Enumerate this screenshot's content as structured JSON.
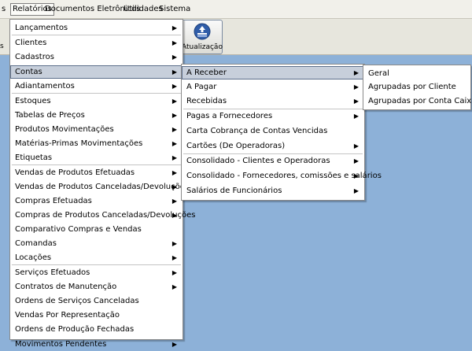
{
  "menubar": {
    "items": [
      "s",
      "Relatórios",
      "Documentos Eletrônicos",
      "Utilidades",
      "Sistema"
    ]
  },
  "toolbar": {
    "left_label": "s",
    "button_label": "Atualização",
    "button_icon": "update-icon"
  },
  "relatorios_menu": {
    "items": [
      {
        "label": "Lançamentos",
        "submenu": true
      },
      {
        "label": "Clientes",
        "submenu": true
      },
      {
        "label": "Cadastros",
        "submenu": true
      },
      {
        "label": "Contas",
        "submenu": true
      },
      {
        "label": "Adiantamentos",
        "submenu": true
      },
      {
        "label": "Estoques",
        "submenu": true
      },
      {
        "label": "Tabelas de Preços",
        "submenu": true
      },
      {
        "label": "Produtos Movimentações",
        "submenu": true
      },
      {
        "label": "Matérias-Primas Movimentações",
        "submenu": true
      },
      {
        "label": "Etiquetas",
        "submenu": true
      },
      {
        "label": "Vendas de Produtos Efetuadas",
        "submenu": true
      },
      {
        "label": "Vendas de Produtos Canceladas/Devoluções",
        "submenu": true
      },
      {
        "label": "Compras Efetuadas",
        "submenu": true
      },
      {
        "label": "Compras de Produtos Canceladas/Devoluções",
        "submenu": true
      },
      {
        "label": "Comparativo Compras e Vendas",
        "submenu": false
      },
      {
        "label": "Comandas",
        "submenu": true
      },
      {
        "label": "Locações",
        "submenu": true
      },
      {
        "label": "Serviços Efetuados",
        "submenu": true
      },
      {
        "label": "Contratos de Manutenção",
        "submenu": true
      },
      {
        "label": "Ordens de Serviços Canceladas",
        "submenu": false
      },
      {
        "label": "Vendas Por Representação",
        "submenu": false
      },
      {
        "label": "Ordens de Produção Fechadas",
        "submenu": false
      },
      {
        "label": "Movimentos Pendentes",
        "submenu": true
      }
    ]
  },
  "contas_menu": {
    "items": [
      {
        "label": "A Receber",
        "submenu": true
      },
      {
        "label": "A Pagar",
        "submenu": true
      },
      {
        "label": "Recebidas",
        "submenu": true
      },
      {
        "label": "Pagas a Fornecedores",
        "submenu": true
      },
      {
        "label": "Carta Cobrança de Contas Vencidas",
        "submenu": false
      },
      {
        "label": "Cartões (De Operadoras)",
        "submenu": true
      },
      {
        "label": "Consolidado - Clientes e Operadoras",
        "submenu": true
      },
      {
        "label": "Consolidado - Fornecedores, comissões e salários",
        "submenu": true
      },
      {
        "label": "Salários de Funcionários",
        "submenu": true
      }
    ]
  },
  "receber_menu": {
    "items": [
      {
        "label": "Geral"
      },
      {
        "label": "Agrupadas por Cliente"
      },
      {
        "label": "Agrupadas por Conta Caixa"
      }
    ]
  },
  "colors": {
    "desktop_background": "#8db1d8",
    "menubar_background": "#f1f0ea",
    "highlight": "#c7cfdb"
  }
}
